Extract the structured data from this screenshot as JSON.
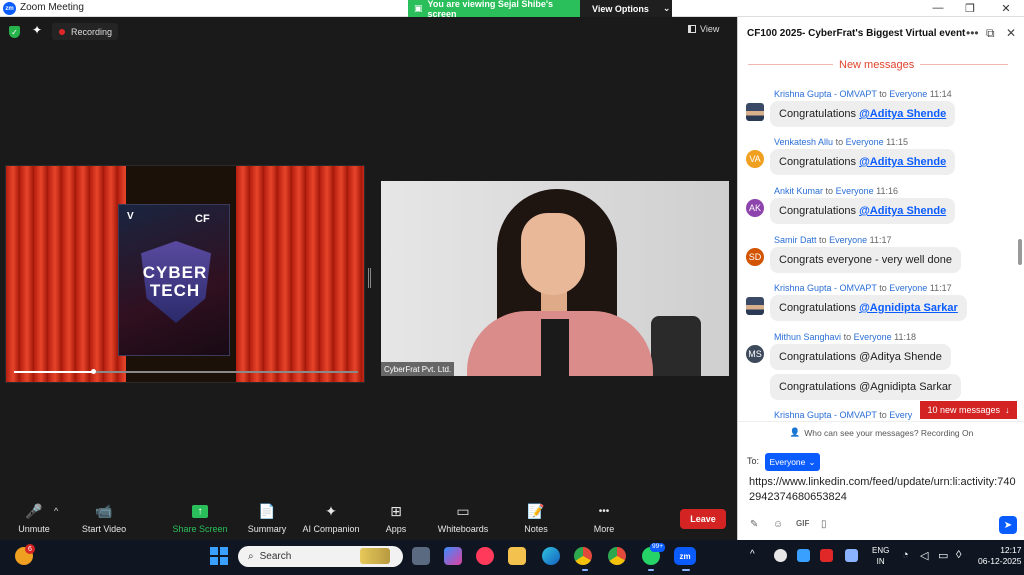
{
  "window": {
    "app_logo": "zm",
    "title": "Zoom Meeting",
    "share_banner": "You are viewing Sejal Shibe's screen",
    "view_options": "View Options",
    "minimize_glyph": "—",
    "maximize_glyph": "❐",
    "close_glyph": "✕"
  },
  "meeting": {
    "recording_label": "Recording",
    "view_label": "View",
    "shared_slide": {
      "top_left": "V",
      "top_right": "CF",
      "line1": "CYBER",
      "line2": "TECH",
      "playback_fraction": 0.23
    },
    "camera_name": "CyberFrat Pvt. Ltd."
  },
  "toolbar": {
    "items": [
      {
        "label": "Unmute",
        "glyph": "🎤"
      },
      {
        "label": "Start Video",
        "glyph": "📹"
      },
      {
        "label": "Share Screen",
        "glyph": "↑"
      },
      {
        "label": "Summary",
        "glyph": "📄"
      },
      {
        "label": "AI Companion",
        "glyph": "✦"
      },
      {
        "label": "Apps",
        "glyph": "⊞"
      },
      {
        "label": "Whiteboards",
        "glyph": "▭"
      },
      {
        "label": "Notes",
        "glyph": "📝"
      },
      {
        "label": "More",
        "glyph": "•••"
      }
    ],
    "unmute_caret": "^",
    "leave_label": "Leave",
    "share_color": "#2bbf5b",
    "leave_color": "#d32323"
  },
  "chat": {
    "title": "CF100 2025- CyberFrat's Biggest Virtual event",
    "more_glyph": "•••",
    "popout_glyph": "⧉",
    "close_glyph": "✕",
    "new_messages_divider": "New messages",
    "to_word": "to",
    "messages": [
      {
        "sender": "Krishna Gupta - OMVAPT",
        "recipient": "Everyone",
        "time": "11:14",
        "avatar": "photo",
        "text": "Congratulations",
        "mention": "@Aditya Shende"
      },
      {
        "sender": "Venkatesh Allu",
        "recipient": "Everyone",
        "time": "11:15",
        "avatar": "VA",
        "avatar_color": "#f0a020",
        "text": "Congratulations",
        "mention": "@Aditya Shende"
      },
      {
        "sender": "Ankit Kumar",
        "recipient": "Everyone",
        "time": "11:16",
        "avatar": "AK",
        "avatar_color": "#8e44ad",
        "text": "Congratulations",
        "mention": "@Aditya Shende"
      },
      {
        "sender": "Samir Datt",
        "recipient": "Everyone",
        "time": "11:17",
        "avatar": "SD",
        "avatar_color": "#d35400",
        "text": "Congrats everyone - very well done",
        "mention": ""
      },
      {
        "sender": "Krishna Gupta - OMVAPT",
        "recipient": "Everyone",
        "time": "11:17",
        "avatar": "photo",
        "text": "Congratulations",
        "mention": "@Agnidipta Sarkar"
      },
      {
        "sender": "Mithun Sanghavi",
        "recipient": "Everyone",
        "time": "11:18",
        "avatar": "MS",
        "avatar_color": "#3d4a5c",
        "text": "Congratulations @Aditya Shende",
        "mention": ""
      },
      {
        "sender": "",
        "recipient": "",
        "time": "",
        "avatar": "",
        "text": "Congratulations @Agnidipta Sarkar",
        "mention": ""
      }
    ],
    "partial_sender": "Krishna Gupta - OMVAPT",
    "partial_to": "to",
    "partial_recipient": "Every",
    "new_messages_button": "10 new messages",
    "who_can_see": "Who can see your messages? Recording On",
    "to_label": "To:",
    "to_value": "Everyone",
    "draft": "https://www.linkedin.com/feed/update/urn:li:activity:7402942374680653824",
    "gif_label": "GIF"
  },
  "taskbar": {
    "weather_badge": "6",
    "search_placeholder": "Search",
    "lang_line1": "ENG",
    "lang_line2": "IN",
    "time": "12:17",
    "date": "06-12-2025",
    "zoom_app_label": "zm",
    "whatsapp_badge": "99+"
  }
}
